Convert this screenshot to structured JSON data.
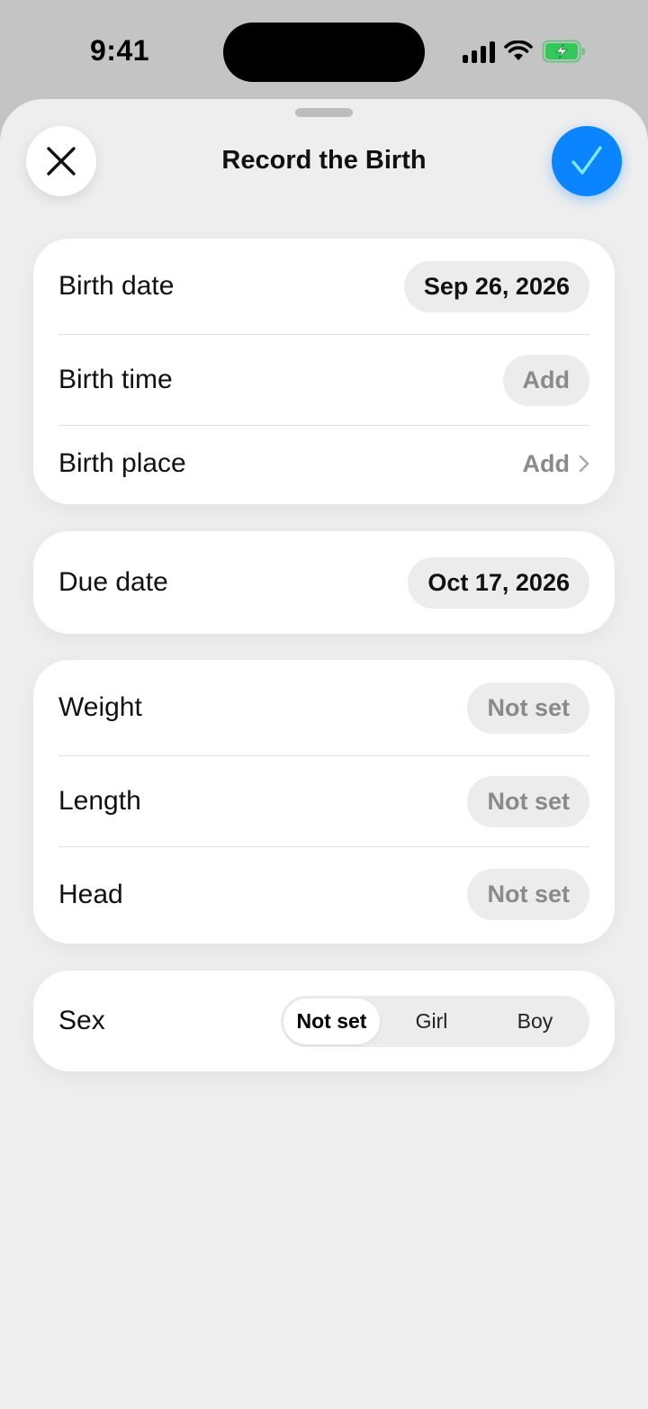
{
  "status_bar": {
    "time": "9:41",
    "signal_icon": "cellular-signal-icon",
    "wifi_icon": "wifi-icon",
    "battery_icon": "battery-charging-icon",
    "battery_color": "#34c759"
  },
  "sheet": {
    "title": "Record the Birth",
    "close_icon": "close-icon",
    "confirm_icon": "checkmark-icon",
    "accent_color": "#0a84ff"
  },
  "birth_card": {
    "birth_date_label": "Birth date",
    "birth_date_value": "Sep 26, 2026",
    "birth_time_label": "Birth time",
    "birth_time_value": "Add",
    "birth_place_label": "Birth place",
    "birth_place_value": "Add"
  },
  "due_card": {
    "due_date_label": "Due date",
    "due_date_value": "Oct 17, 2026"
  },
  "measurements_card": {
    "weight_label": "Weight",
    "weight_value": "Not set",
    "length_label": "Length",
    "length_value": "Not set",
    "head_label": "Head",
    "head_value": "Not set"
  },
  "sex_card": {
    "label": "Sex",
    "options": [
      "Not set",
      "Girl",
      "Boy"
    ],
    "selected": "Not set"
  }
}
